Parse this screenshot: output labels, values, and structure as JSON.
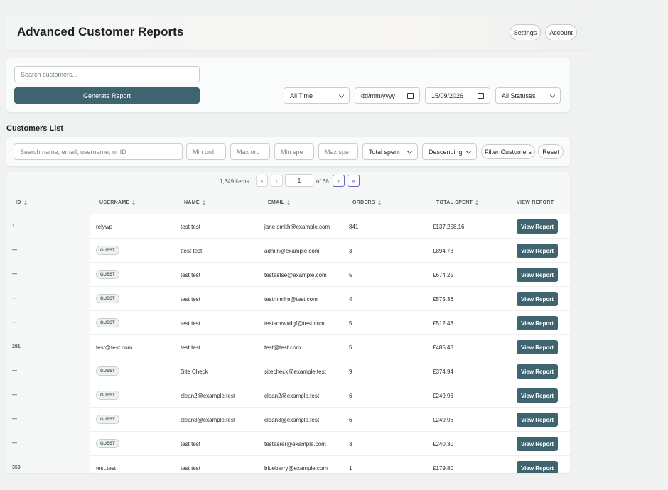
{
  "header": {
    "title": "Advanced Customer Reports",
    "settings_label": "Settings",
    "account_label": "Account"
  },
  "report": {
    "search_placeholder": "Search customers...",
    "generate_label": "Generate Report",
    "period": "All Time",
    "date_from": "dd/mm/yyyy",
    "date_to": "15/09/2026",
    "status": "All Statuses"
  },
  "customers": {
    "title": "Customers List",
    "search_placeholder": "Search name, email, username, or ID",
    "min_orders": "Min ord",
    "max_orders": "Max orc",
    "min_spent": "Min spe",
    "max_spent": "Max spe",
    "sort_by": "Total spent",
    "sort_dir": "Descending",
    "filter_label": "Filter Customers",
    "reset_label": "Reset"
  },
  "pager": {
    "count": "1,349 items",
    "first": "«",
    "prev": "‹",
    "page": "1",
    "of": "of 68",
    "next": "›",
    "last": "»"
  },
  "table": {
    "headers": [
      "ID",
      "USERNAME",
      "NAME",
      "EMAIL",
      "ORDERS",
      "TOTAL SPENT",
      "VIEW REPORT"
    ],
    "view_label": "View Report",
    "guest_label": "GUEST",
    "rows": [
      {
        "id": "1",
        "username": "relywp",
        "guest": false,
        "name": "test test",
        "email": "jane.smith@example.com",
        "orders": "841",
        "total": "£137,258.16"
      },
      {
        "id": "—",
        "username": "",
        "guest": true,
        "name": "ttest test",
        "email": "admin@example.com",
        "orders": "3",
        "total": "£894.73"
      },
      {
        "id": "—",
        "username": "",
        "guest": true,
        "name": "test test",
        "email": "testestse@example.com",
        "orders": "5",
        "total": "£674.25"
      },
      {
        "id": "—",
        "username": "",
        "guest": true,
        "name": "test test",
        "email": "testmlmlm@test.com",
        "orders": "4",
        "total": "£575.36"
      },
      {
        "id": "—",
        "username": "",
        "guest": true,
        "name": "test test",
        "email": "testsdvwxdgf@test.com",
        "orders": "5",
        "total": "£512.43"
      },
      {
        "id": "291",
        "username": "test@test.com",
        "guest": false,
        "name": "test test",
        "email": "test@test.com",
        "orders": "5",
        "total": "£485.48"
      },
      {
        "id": "—",
        "username": "",
        "guest": true,
        "name": "Site Check",
        "email": "sitecheck@example.test",
        "orders": "9",
        "total": "£374.94"
      },
      {
        "id": "—",
        "username": "",
        "guest": true,
        "name": "clean2@example.test",
        "email": "clean2@example.test",
        "orders": "6",
        "total": "£249.96"
      },
      {
        "id": "—",
        "username": "",
        "guest": true,
        "name": "clean3@example.test",
        "email": "clean3@example.test",
        "orders": "6",
        "total": "£249.96"
      },
      {
        "id": "—",
        "username": "",
        "guest": true,
        "name": "test test",
        "email": "testesrer@example.com",
        "orders": "3",
        "total": "£240.30"
      },
      {
        "id": "350",
        "username": "test.test",
        "guest": false,
        "name": "test test",
        "email": "blueberry@example.com",
        "orders": "1",
        "total": "£179.80"
      }
    ]
  }
}
